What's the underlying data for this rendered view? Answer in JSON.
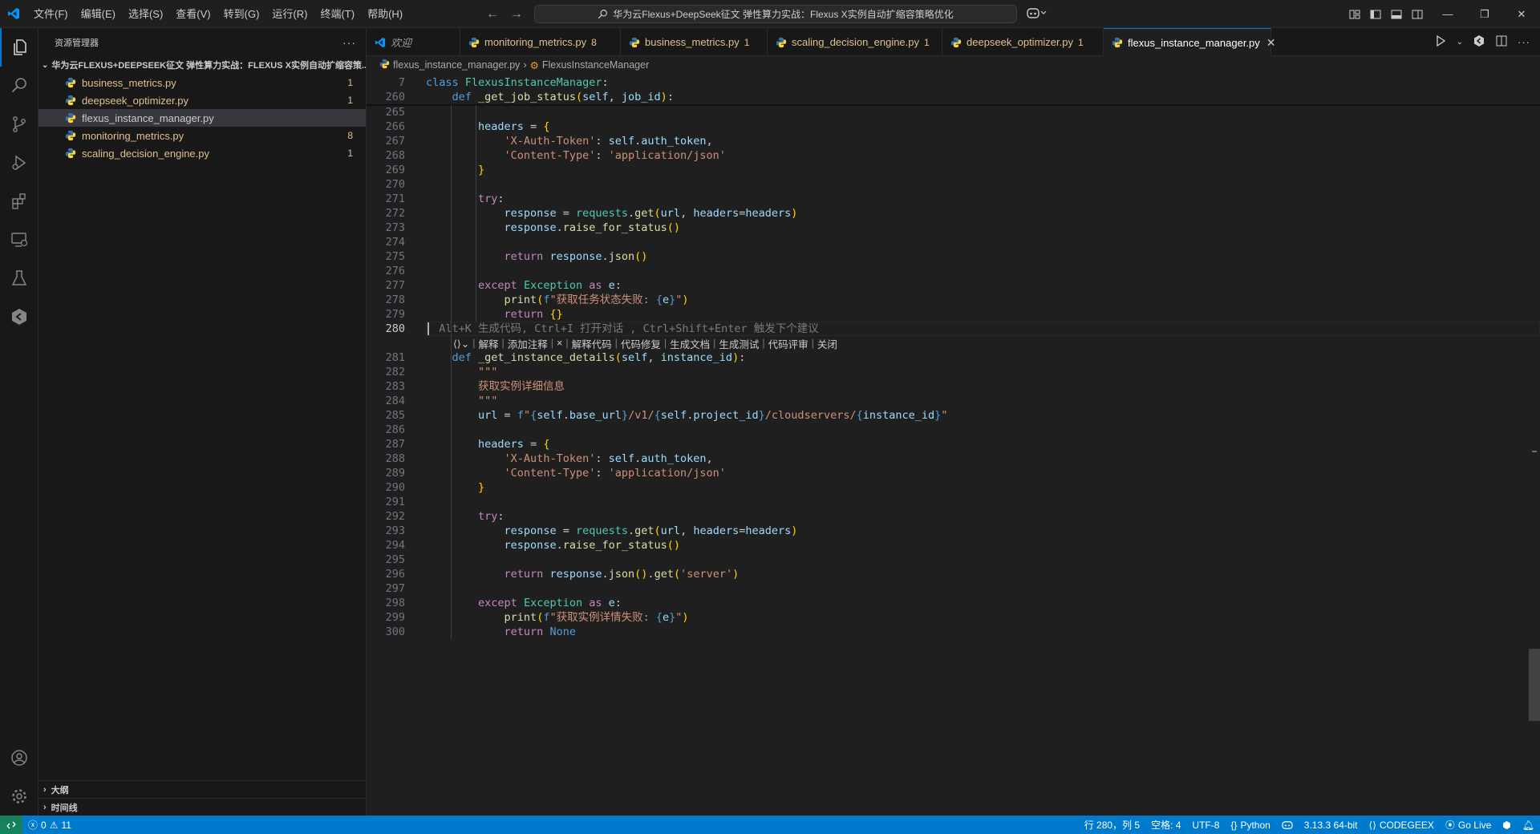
{
  "menu": [
    "文件(F)",
    "编辑(E)",
    "选择(S)",
    "查看(V)",
    "转到(G)",
    "运行(R)",
    "终端(T)",
    "帮助(H)"
  ],
  "title": "华为云Flexus+DeepSeek征文 弹性算力实战：Flexus X实例自动扩缩容策略优化",
  "sidebar": {
    "header": "资源管理器",
    "project": "华为云FLEXUS+DEEPSEEK征文 弹性算力实战：FLEXUS X实例自动扩缩容策...",
    "files": [
      {
        "name": "business_metrics.py",
        "count": "1"
      },
      {
        "name": "deepseek_optimizer.py",
        "count": "1"
      },
      {
        "name": "flexus_instance_manager.py",
        "count": ""
      },
      {
        "name": "monitoring_metrics.py",
        "count": "8"
      },
      {
        "name": "scaling_decision_engine.py",
        "count": "1"
      }
    ],
    "outline": "大纲",
    "timeline": "时间线"
  },
  "tabs": [
    {
      "name": "欢迎",
      "count": ""
    },
    {
      "name": "monitoring_metrics.py",
      "count": "8"
    },
    {
      "name": "business_metrics.py",
      "count": "1"
    },
    {
      "name": "scaling_decision_engine.py",
      "count": "1"
    },
    {
      "name": "deepseek_optimizer.py",
      "count": "1"
    },
    {
      "name": "flexus_instance_manager.py",
      "count": ""
    }
  ],
  "breadcrumb": {
    "file": "flexus_instance_manager.py",
    "symbol": "FlexusInstanceManager"
  },
  "editor": {
    "sticky": [
      {
        "n": "7",
        "html": "<span class=\"kw\">class</span> <span class=\"cls\">FlexusInstanceManager</span><span class=\"punc\">:</span>"
      },
      {
        "n": "260",
        "html": "    <span class=\"kw\">def</span> <span class=\"fn\">_get_job_status</span><span class=\"br\">(</span><span class=\"var\">self</span>, <span class=\"var\">job_id</span><span class=\"br\">)</span>:"
      }
    ],
    "lines": [
      {
        "n": "265",
        "html": ""
      },
      {
        "n": "266",
        "html": "        <span class=\"var\">headers</span> = <span class=\"br\">{</span>"
      },
      {
        "n": "267",
        "html": "            <span class=\"str\">'X-Auth-Token'</span>: <span class=\"var\">self</span>.<span class=\"var\">auth_token</span>,"
      },
      {
        "n": "268",
        "html": "            <span class=\"str\">'Content-Type'</span>: <span class=\"str\">'application/json'</span>"
      },
      {
        "n": "269",
        "html": "        <span class=\"br\">}</span>"
      },
      {
        "n": "270",
        "html": ""
      },
      {
        "n": "271",
        "html": "        <span class=\"kw2\">try</span>:"
      },
      {
        "n": "272",
        "html": "            <span class=\"var\">response</span> = <span class=\"cls\">requests</span>.<span class=\"fn\">get</span><span class=\"br\">(</span><span class=\"var\">url</span>, <span class=\"var\">headers</span>=<span class=\"var\">headers</span><span class=\"br\">)</span>"
      },
      {
        "n": "273",
        "html": "            <span class=\"var\">response</span>.<span class=\"fn\">raise_for_status</span><span class=\"br\">()</span>"
      },
      {
        "n": "274",
        "html": ""
      },
      {
        "n": "275",
        "html": "            <span class=\"kw2\">return</span> <span class=\"var\">response</span>.<span class=\"fn\">json</span><span class=\"br\">()</span>"
      },
      {
        "n": "276",
        "html": ""
      },
      {
        "n": "277",
        "html": "        <span class=\"kw2\">except</span> <span class=\"cls\">Exception</span> <span class=\"kw2\">as</span> <span class=\"var\">e</span>:"
      },
      {
        "n": "278",
        "html": "            <span class=\"fn\">print</span><span class=\"br\">(</span><span class=\"kw\">f</span><span class=\"str\">\"获取任务状态失败: </span><span class=\"kw\">{</span><span class=\"var\">e</span><span class=\"kw\">}</span><span class=\"str\">\"</span><span class=\"br\">)</span>"
      },
      {
        "n": "279",
        "html": "            <span class=\"kw2\">return</span> <span class=\"br\">{}</span>"
      },
      {
        "n": "280",
        "html": "  <span class=\"hint\">Alt+K 生成代码, Ctrl+I 打开对话 , Ctrl+Shift+Enter 触发下个建议</span>",
        "cur": true
      },
      {
        "n": "",
        "html": "",
        "lens": true
      },
      {
        "n": "281",
        "html": "    <span class=\"kw\">def</span> <span class=\"fn\">_get_instance_details</span><span class=\"br\">(</span><span class=\"var\">self</span>, <span class=\"var\">instance_id</span><span class=\"br\">)</span>:"
      },
      {
        "n": "282",
        "html": "        <span class=\"str\">\"\"\"</span>"
      },
      {
        "n": "283",
        "html": "        <span class=\"str\">获取实例详细信息</span>"
      },
      {
        "n": "284",
        "html": "        <span class=\"str\">\"\"\"</span>"
      },
      {
        "n": "285",
        "html": "        <span class=\"var\">url</span> = <span class=\"kw\">f</span><span class=\"str\">\"</span><span class=\"kw\">{</span><span class=\"var\">self</span>.<span class=\"var\">base_url</span><span class=\"kw\">}</span><span class=\"str\">/v1/</span><span class=\"kw\">{</span><span class=\"var\">self</span>.<span class=\"var\">project_id</span><span class=\"kw\">}</span><span class=\"str\">/cloudservers/</span><span class=\"kw\">{</span><span class=\"var\">instance_id</span><span class=\"kw\">}</span><span class=\"str\">\"</span>"
      },
      {
        "n": "286",
        "html": ""
      },
      {
        "n": "287",
        "html": "        <span class=\"var\">headers</span> = <span class=\"br\">{</span>"
      },
      {
        "n": "288",
        "html": "            <span class=\"str\">'X-Auth-Token'</span>: <span class=\"var\">self</span>.<span class=\"var\">auth_token</span>,"
      },
      {
        "n": "289",
        "html": "            <span class=\"str\">'Content-Type'</span>: <span class=\"str\">'application/json'</span>"
      },
      {
        "n": "290",
        "html": "        <span class=\"br\">}</span>"
      },
      {
        "n": "291",
        "html": ""
      },
      {
        "n": "292",
        "html": "        <span class=\"kw2\">try</span>:"
      },
      {
        "n": "293",
        "html": "            <span class=\"var\">response</span> = <span class=\"cls\">requests</span>.<span class=\"fn\">get</span><span class=\"br\">(</span><span class=\"var\">url</span>, <span class=\"var\">headers</span>=<span class=\"var\">headers</span><span class=\"br\">)</span>"
      },
      {
        "n": "294",
        "html": "            <span class=\"var\">response</span>.<span class=\"fn\">raise_for_status</span><span class=\"br\">()</span>"
      },
      {
        "n": "295",
        "html": ""
      },
      {
        "n": "296",
        "html": "            <span class=\"kw2\">return</span> <span class=\"var\">response</span>.<span class=\"fn\">json</span><span class=\"br\">()</span>.<span class=\"fn\">get</span><span class=\"br\">(</span><span class=\"str\">'server'</span><span class=\"br\">)</span>"
      },
      {
        "n": "297",
        "html": ""
      },
      {
        "n": "298",
        "html": "        <span class=\"kw2\">except</span> <span class=\"cls\">Exception</span> <span class=\"kw2\">as</span> <span class=\"var\">e</span>:"
      },
      {
        "n": "299",
        "html": "            <span class=\"fn\">print</span><span class=\"br\">(</span><span class=\"kw\">f</span><span class=\"str\">\"获取实例详情失败: </span><span class=\"kw\">{</span><span class=\"var\">e</span><span class=\"kw\">}</span><span class=\"str\">\"</span><span class=\"br\">)</span>"
      },
      {
        "n": "300",
        "html": "            <span class=\"kw2\">return</span> <span class=\"kw\">None</span>"
      }
    ],
    "codelens": [
      "解释",
      "添加注释",
      "×",
      "解释代码",
      "代码修复",
      "生成文档",
      "生成测试",
      "代码评审",
      "关闭"
    ]
  },
  "status": {
    "errors": "0",
    "warnings": "11",
    "position": "行 280，列 5",
    "spaces": "空格: 4",
    "encoding": "UTF-8",
    "language": "Python",
    "interpreter": "3.13.3 64-bit",
    "codegeex": "CODEGEEX",
    "golive": "Go Live"
  },
  "colors": {
    "accent": "#0078d4",
    "statusbar": "#007acc",
    "warning": "#e2c08d"
  }
}
